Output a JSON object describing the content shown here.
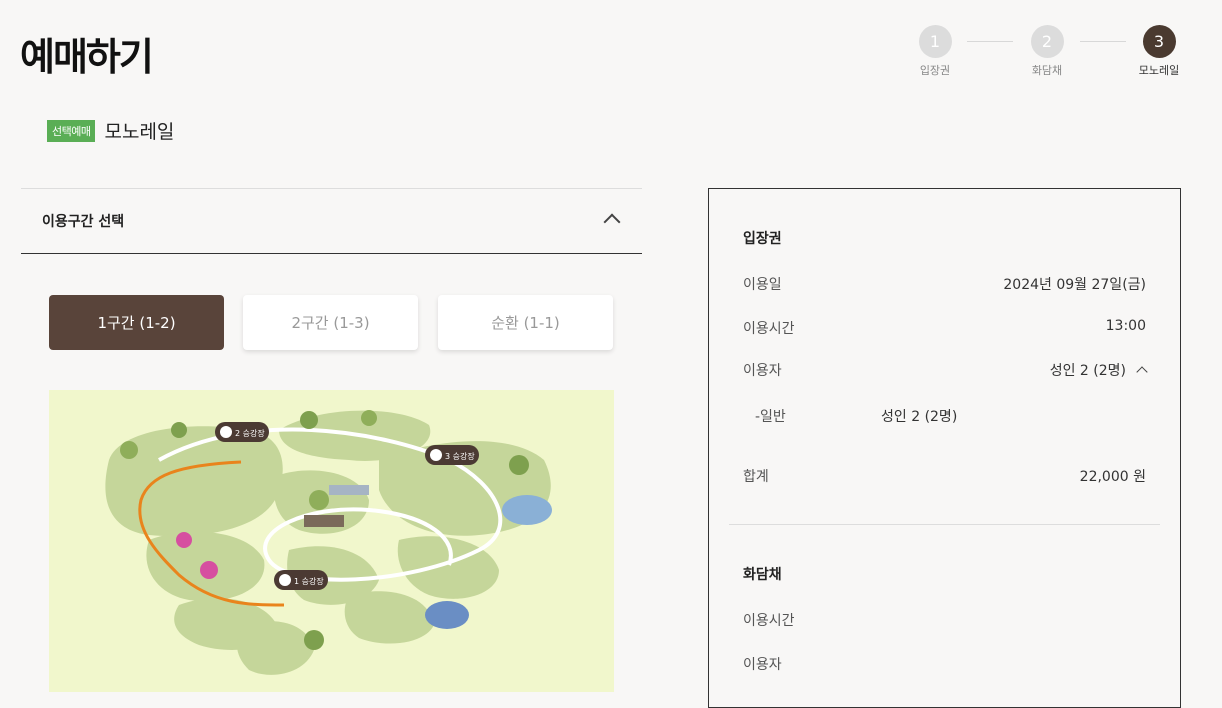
{
  "page": {
    "title": "예매하기"
  },
  "stepper": {
    "steps": [
      {
        "num": "1",
        "label": "입장권"
      },
      {
        "num": "2",
        "label": "화담채"
      },
      {
        "num": "3",
        "label": "모노레일"
      }
    ]
  },
  "selected": {
    "badge": "선택예매",
    "name": "모노레일"
  },
  "section": {
    "title": "이용구간 선택"
  },
  "segments": [
    "1구간 (1-2)",
    "2구간 (1-3)",
    "순환 (1-1)"
  ],
  "map": {
    "stations": [
      "2 승강장",
      "3 승강장",
      "1 승강장"
    ],
    "colors": {
      "background": "#f1f7cc",
      "route": "#e9841c",
      "path": "#ffffff",
      "station": "#4b3a33"
    }
  },
  "summary": {
    "ticket": {
      "title": "입장권",
      "date_label": "이용일",
      "date_value": "2024년 09월 27일(금)",
      "time_label": "이용시간",
      "time_value": "13:00",
      "user_label": "이용자",
      "user_value": "성인 2 (2명)",
      "sub_label": "-일반",
      "sub_value": "성인 2 (2명)",
      "total_label": "합계",
      "total_value": "22,000 원"
    },
    "hwadam": {
      "title": "화담채",
      "time_label": "이용시간",
      "user_label": "이용자"
    }
  }
}
